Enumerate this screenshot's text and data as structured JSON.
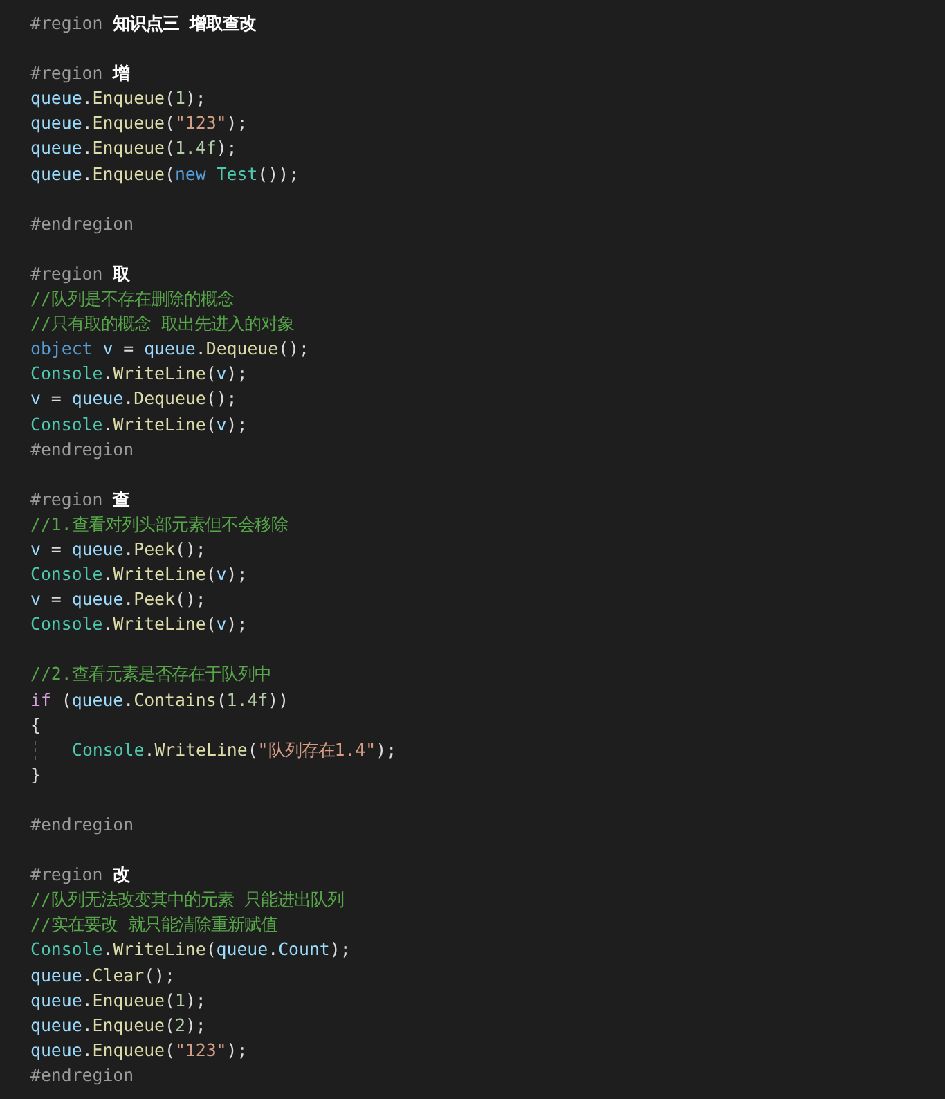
{
  "editor": {
    "lines": [
      {
        "indented": false,
        "tokens": [
          {
            "kind": "directive",
            "text": "#region"
          },
          {
            "kind": "region_name",
            "text": " 知识点三 增取查改"
          }
        ]
      },
      {
        "indented": false
      },
      {
        "indented": false,
        "tokens": [
          {
            "kind": "directive",
            "text": "#region"
          },
          {
            "kind": "region_name",
            "text": " 增"
          }
        ]
      },
      {
        "indented": false,
        "tokens": [
          {
            "kind": "variable",
            "text": "queue"
          },
          {
            "kind": "plain",
            "text": "."
          },
          {
            "kind": "method",
            "text": "Enqueue"
          },
          {
            "kind": "plain",
            "text": "("
          },
          {
            "kind": "number",
            "text": "1"
          },
          {
            "kind": "plain",
            "text": ");"
          }
        ]
      },
      {
        "indented": false,
        "tokens": [
          {
            "kind": "variable",
            "text": "queue"
          },
          {
            "kind": "plain",
            "text": "."
          },
          {
            "kind": "method",
            "text": "Enqueue"
          },
          {
            "kind": "plain",
            "text": "("
          },
          {
            "kind": "string",
            "text": "\"123\""
          },
          {
            "kind": "plain",
            "text": ");"
          }
        ]
      },
      {
        "indented": false,
        "tokens": [
          {
            "kind": "variable",
            "text": "queue"
          },
          {
            "kind": "plain",
            "text": "."
          },
          {
            "kind": "method",
            "text": "Enqueue"
          },
          {
            "kind": "plain",
            "text": "("
          },
          {
            "kind": "number",
            "text": "1.4f"
          },
          {
            "kind": "plain",
            "text": ");"
          }
        ]
      },
      {
        "indented": false,
        "tokens": [
          {
            "kind": "variable",
            "text": "queue"
          },
          {
            "kind": "plain",
            "text": "."
          },
          {
            "kind": "method",
            "text": "Enqueue"
          },
          {
            "kind": "plain",
            "text": "("
          },
          {
            "kind": "keyword",
            "text": "new"
          },
          {
            "kind": "type",
            "text": " Test"
          },
          {
            "kind": "plain",
            "text": "());"
          }
        ]
      },
      {
        "indented": false
      },
      {
        "indented": false,
        "tokens": [
          {
            "kind": "directive",
            "text": "#endregion"
          }
        ]
      },
      {
        "indented": false
      },
      {
        "indented": false,
        "tokens": [
          {
            "kind": "directive",
            "text": "#region"
          },
          {
            "kind": "region_name",
            "text": " 取"
          }
        ]
      },
      {
        "indented": false,
        "tokens": [
          {
            "kind": "comment",
            "text": "//队列是不存在删除的概念"
          }
        ]
      },
      {
        "indented": false,
        "tokens": [
          {
            "kind": "comment",
            "text": "//只有取的概念 取出先进入的对象"
          }
        ]
      },
      {
        "indented": false,
        "tokens": [
          {
            "kind": "keyword",
            "text": "object"
          },
          {
            "kind": "variable",
            "text": " v"
          },
          {
            "kind": "plain",
            "text": " = "
          },
          {
            "kind": "variable",
            "text": "queue"
          },
          {
            "kind": "plain",
            "text": "."
          },
          {
            "kind": "method",
            "text": "Dequeue"
          },
          {
            "kind": "plain",
            "text": "();"
          }
        ]
      },
      {
        "indented": false,
        "tokens": [
          {
            "kind": "type",
            "text": "Console"
          },
          {
            "kind": "plain",
            "text": "."
          },
          {
            "kind": "method",
            "text": "WriteLine"
          },
          {
            "kind": "plain",
            "text": "("
          },
          {
            "kind": "variable",
            "text": "v"
          },
          {
            "kind": "plain",
            "text": ");"
          }
        ]
      },
      {
        "indented": false,
        "tokens": [
          {
            "kind": "variable",
            "text": "v"
          },
          {
            "kind": "plain",
            "text": " = "
          },
          {
            "kind": "variable",
            "text": "queue"
          },
          {
            "kind": "plain",
            "text": "."
          },
          {
            "kind": "method",
            "text": "Dequeue"
          },
          {
            "kind": "plain",
            "text": "();"
          }
        ]
      },
      {
        "indented": false,
        "tokens": [
          {
            "kind": "type",
            "text": "Console"
          },
          {
            "kind": "plain",
            "text": "."
          },
          {
            "kind": "method",
            "text": "WriteLine"
          },
          {
            "kind": "plain",
            "text": "("
          },
          {
            "kind": "variable",
            "text": "v"
          },
          {
            "kind": "plain",
            "text": ");"
          }
        ]
      },
      {
        "indented": false,
        "tokens": [
          {
            "kind": "directive",
            "text": "#endregion"
          }
        ]
      },
      {
        "indented": false
      },
      {
        "indented": false,
        "tokens": [
          {
            "kind": "directive",
            "text": "#region"
          },
          {
            "kind": "region_name",
            "text": " 查"
          }
        ]
      },
      {
        "indented": false,
        "tokens": [
          {
            "kind": "comment",
            "text": "//1.查看对列头部元素但不会移除"
          }
        ]
      },
      {
        "indented": false,
        "tokens": [
          {
            "kind": "variable",
            "text": "v"
          },
          {
            "kind": "plain",
            "text": " = "
          },
          {
            "kind": "variable",
            "text": "queue"
          },
          {
            "kind": "plain",
            "text": "."
          },
          {
            "kind": "method",
            "text": "Peek"
          },
          {
            "kind": "plain",
            "text": "();"
          }
        ]
      },
      {
        "indented": false,
        "tokens": [
          {
            "kind": "type",
            "text": "Console"
          },
          {
            "kind": "plain",
            "text": "."
          },
          {
            "kind": "method",
            "text": "WriteLine"
          },
          {
            "kind": "plain",
            "text": "("
          },
          {
            "kind": "variable",
            "text": "v"
          },
          {
            "kind": "plain",
            "text": ");"
          }
        ]
      },
      {
        "indented": false,
        "tokens": [
          {
            "kind": "variable",
            "text": "v"
          },
          {
            "kind": "plain",
            "text": " = "
          },
          {
            "kind": "variable",
            "text": "queue"
          },
          {
            "kind": "plain",
            "text": "."
          },
          {
            "kind": "method",
            "text": "Peek"
          },
          {
            "kind": "plain",
            "text": "();"
          }
        ]
      },
      {
        "indented": false,
        "tokens": [
          {
            "kind": "type",
            "text": "Console"
          },
          {
            "kind": "plain",
            "text": "."
          },
          {
            "kind": "method",
            "text": "WriteLine"
          },
          {
            "kind": "plain",
            "text": "("
          },
          {
            "kind": "variable",
            "text": "v"
          },
          {
            "kind": "plain",
            "text": ");"
          }
        ]
      },
      {
        "indented": false
      },
      {
        "indented": false,
        "tokens": [
          {
            "kind": "comment",
            "text": "//2.查看元素是否存在于队列中"
          }
        ]
      },
      {
        "indented": false,
        "tokens": [
          {
            "kind": "control",
            "text": "if"
          },
          {
            "kind": "plain",
            "text": " ("
          },
          {
            "kind": "variable",
            "text": "queue"
          },
          {
            "kind": "plain",
            "text": "."
          },
          {
            "kind": "method",
            "text": "Contains"
          },
          {
            "kind": "plain",
            "text": "("
          },
          {
            "kind": "number",
            "text": "1.4f"
          },
          {
            "kind": "plain",
            "text": "))"
          }
        ]
      },
      {
        "indented": false,
        "tokens": [
          {
            "kind": "plain",
            "text": "{"
          }
        ]
      },
      {
        "indented": true,
        "tokens": [
          {
            "kind": "type",
            "text": "Console"
          },
          {
            "kind": "plain",
            "text": "."
          },
          {
            "kind": "method",
            "text": "WriteLine"
          },
          {
            "kind": "plain",
            "text": "("
          },
          {
            "kind": "string",
            "text": "\"队列存在1.4\""
          },
          {
            "kind": "plain",
            "text": ");"
          }
        ]
      },
      {
        "indented": false,
        "tokens": [
          {
            "kind": "plain",
            "text": "}"
          }
        ]
      },
      {
        "indented": false
      },
      {
        "indented": false,
        "tokens": [
          {
            "kind": "directive",
            "text": "#endregion"
          }
        ]
      },
      {
        "indented": false
      },
      {
        "indented": false,
        "tokens": [
          {
            "kind": "directive",
            "text": "#region"
          },
          {
            "kind": "region_name",
            "text": " 改"
          }
        ]
      },
      {
        "indented": false,
        "tokens": [
          {
            "kind": "comment",
            "text": "//队列无法改变其中的元素 只能进出队列"
          }
        ]
      },
      {
        "indented": false,
        "tokens": [
          {
            "kind": "comment",
            "text": "//实在要改 就只能清除重新赋值"
          }
        ]
      },
      {
        "indented": false,
        "tokens": [
          {
            "kind": "type",
            "text": "Console"
          },
          {
            "kind": "plain",
            "text": "."
          },
          {
            "kind": "method",
            "text": "WriteLine"
          },
          {
            "kind": "plain",
            "text": "("
          },
          {
            "kind": "variable",
            "text": "queue"
          },
          {
            "kind": "plain",
            "text": "."
          },
          {
            "kind": "variable",
            "text": "Count"
          },
          {
            "kind": "plain",
            "text": ");"
          }
        ]
      },
      {
        "indented": false,
        "tokens": [
          {
            "kind": "variable",
            "text": "queue"
          },
          {
            "kind": "plain",
            "text": "."
          },
          {
            "kind": "method",
            "text": "Clear"
          },
          {
            "kind": "plain",
            "text": "();"
          }
        ]
      },
      {
        "indented": false,
        "tokens": [
          {
            "kind": "variable",
            "text": "queue"
          },
          {
            "kind": "plain",
            "text": "."
          },
          {
            "kind": "method",
            "text": "Enqueue"
          },
          {
            "kind": "plain",
            "text": "("
          },
          {
            "kind": "number",
            "text": "1"
          },
          {
            "kind": "plain",
            "text": ");"
          }
        ]
      },
      {
        "indented": false,
        "tokens": [
          {
            "kind": "variable",
            "text": "queue"
          },
          {
            "kind": "plain",
            "text": "."
          },
          {
            "kind": "method",
            "text": "Enqueue"
          },
          {
            "kind": "plain",
            "text": "("
          },
          {
            "kind": "number",
            "text": "2"
          },
          {
            "kind": "plain",
            "text": ");"
          }
        ]
      },
      {
        "indented": false,
        "tokens": [
          {
            "kind": "variable",
            "text": "queue"
          },
          {
            "kind": "plain",
            "text": "."
          },
          {
            "kind": "method",
            "text": "Enqueue"
          },
          {
            "kind": "plain",
            "text": "("
          },
          {
            "kind": "string",
            "text": "\"123\""
          },
          {
            "kind": "plain",
            "text": ");"
          }
        ]
      },
      {
        "indented": false,
        "tokens": [
          {
            "kind": "directive",
            "text": "#endregion"
          }
        ]
      }
    ]
  }
}
